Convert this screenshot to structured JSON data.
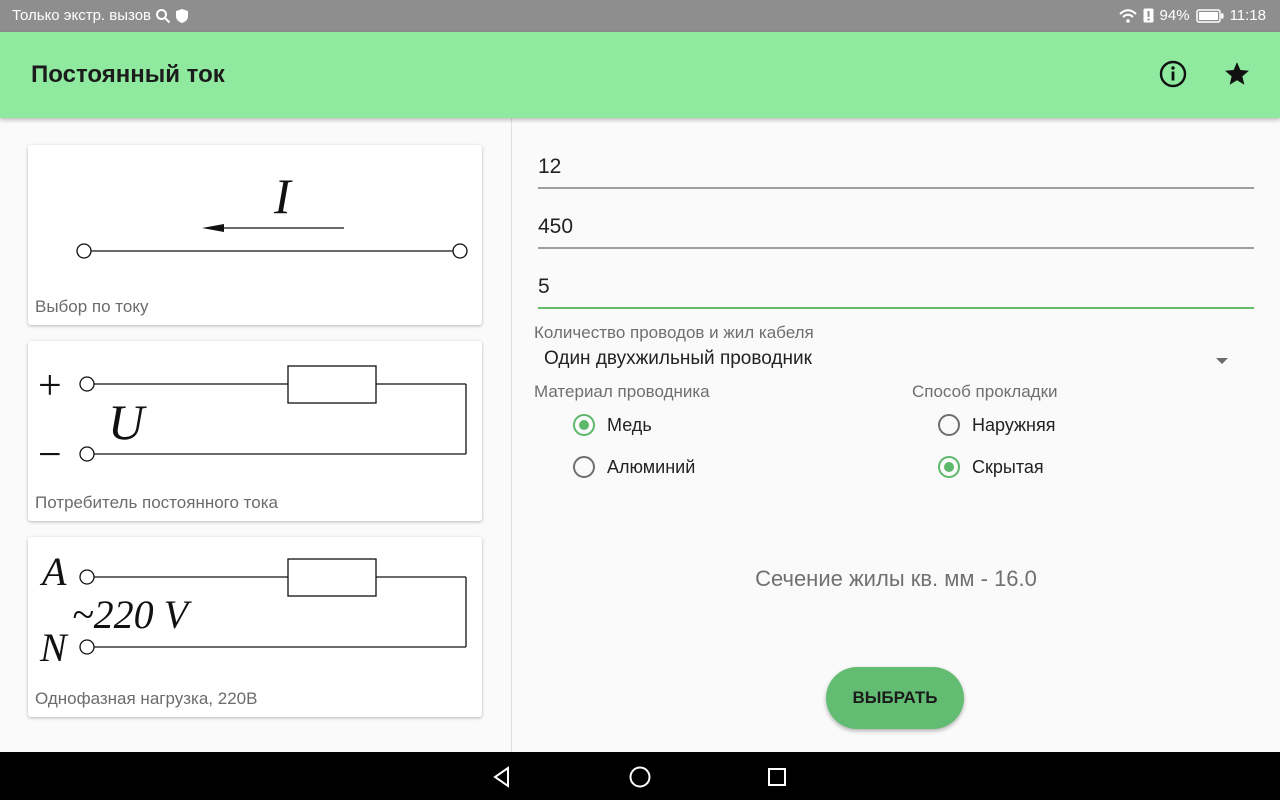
{
  "status_bar": {
    "carrier_text": "Только экстр. вызов",
    "battery_percent": "94%",
    "time": "11:18"
  },
  "app_bar": {
    "title": "Постоянный ток",
    "info_icon": "info-icon",
    "favorite_icon": "star-icon",
    "background": "#8fea9f"
  },
  "cards": [
    {
      "caption": "Выбор по току",
      "diagram": {
        "current_symbol": "I"
      }
    },
    {
      "caption": "Потребитель постоянного тока",
      "diagram": {
        "plus": "+",
        "minus": "−",
        "voltage_symbol": "U"
      }
    },
    {
      "caption": "Однофазная нагрузка, 220В",
      "diagram": {
        "phase": "A",
        "neutral": "N",
        "voltage": "~220 V"
      }
    }
  ],
  "inputs": [
    {
      "value": "12"
    },
    {
      "value": "450"
    },
    {
      "value": "5"
    }
  ],
  "cable": {
    "label": "Количество проводов и жил кабеля",
    "selected": "Один двухжильный проводник"
  },
  "material": {
    "label": "Материал проводника",
    "options": [
      {
        "label": "Медь",
        "checked": true
      },
      {
        "label": "Алюминий",
        "checked": false
      }
    ]
  },
  "laying": {
    "label": "Способ прокладки",
    "options": [
      {
        "label": "Наружняя",
        "checked": false
      },
      {
        "label": "Скрытая",
        "checked": true
      }
    ]
  },
  "result": "Сечение жилы кв. мм - 16.0",
  "button_label": "ВЫБРАТЬ",
  "colors": {
    "accent": "#5cb86a",
    "button": "#62bd72"
  }
}
